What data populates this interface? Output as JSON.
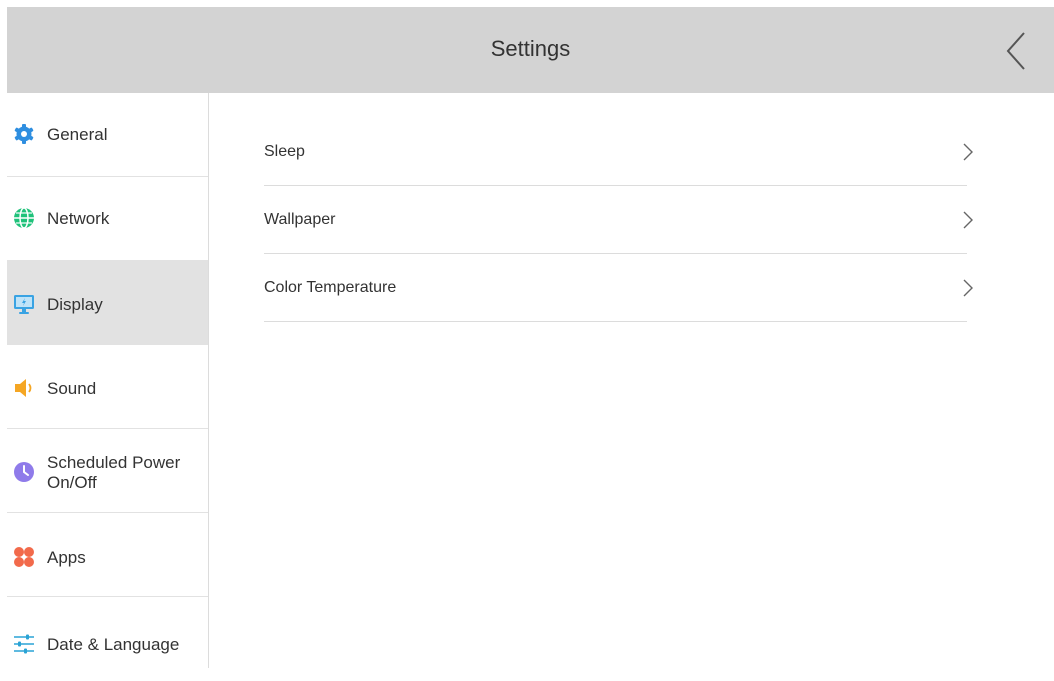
{
  "header": {
    "title": "Settings",
    "back_icon": "chevron-left-icon"
  },
  "sidebar": {
    "items": [
      {
        "label": "General",
        "icon": "gear-icon",
        "color": "#2e8ee0"
      },
      {
        "label": "Network",
        "icon": "globe-icon",
        "color": "#1fc27a"
      },
      {
        "label": "Display",
        "icon": "monitor-icon",
        "color": "#39a3e3",
        "active": true
      },
      {
        "label": "Sound",
        "icon": "speaker-icon",
        "color": "#f5a623"
      },
      {
        "label": "Scheduled Power",
        "label_line2": "On/Off",
        "icon": "clock-icon",
        "color": "#8f7bea"
      },
      {
        "label": "Apps",
        "icon": "apps-icon",
        "color": "#f26a4b"
      },
      {
        "label": "Date & Language",
        "icon": "sliders-icon",
        "color": "#2aa3d5"
      }
    ]
  },
  "content": {
    "items": [
      {
        "label": "Sleep",
        "icon": "chevron-right-icon"
      },
      {
        "label": "Wallpaper",
        "icon": "chevron-right-icon"
      },
      {
        "label": "Color Temperature",
        "icon": "chevron-right-icon"
      }
    ]
  }
}
